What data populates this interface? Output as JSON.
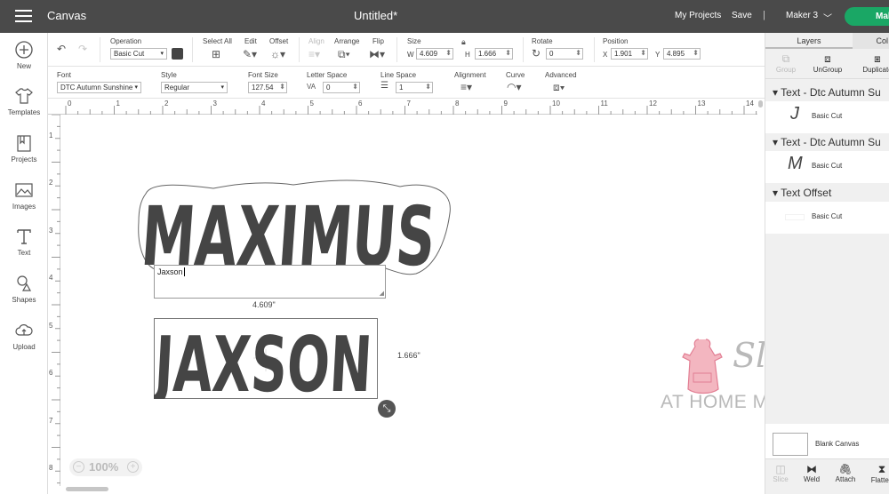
{
  "topbar": {
    "app_title": "Canvas",
    "doc_title": "Untitled*",
    "my_projects": "My Projects",
    "save": "Save",
    "separator": "|",
    "machine": "Maker 3",
    "make": "Make"
  },
  "sidebar": {
    "items": [
      {
        "label": "New",
        "icon": "plus-circle-icon"
      },
      {
        "label": "Templates",
        "icon": "tshirt-icon"
      },
      {
        "label": "Projects",
        "icon": "projects-icon"
      },
      {
        "label": "Images",
        "icon": "image-icon"
      },
      {
        "label": "Text",
        "icon": "text-icon"
      },
      {
        "label": "Shapes",
        "icon": "shapes-icon"
      },
      {
        "label": "Upload",
        "icon": "upload-cloud-icon"
      }
    ]
  },
  "toolbar1": {
    "operation_label": "Operation",
    "operation_value": "Basic Cut",
    "select_all": "Select All",
    "edit": "Edit",
    "offset": "Offset",
    "align": "Align",
    "arrange": "Arrange",
    "flip": "Flip",
    "size": "Size",
    "w_label": "W",
    "w_value": "4.609",
    "h_label": "H",
    "h_value": "1.666",
    "rotate": "Rotate",
    "rotate_value": "0",
    "position": "Position",
    "x_label": "X",
    "x_value": "1.901",
    "y_label": "Y",
    "y_value": "4.895"
  },
  "toolbar2": {
    "font_label": "Font",
    "font_value": "DTC Autumn Sunshine",
    "style_label": "Style",
    "style_value": "Regular",
    "font_size_label": "Font Size",
    "font_size_value": "127.54",
    "letter_space_label": "Letter Space",
    "letter_space_value": "0",
    "line_space_label": "Line Space",
    "line_space_value": "1",
    "alignment_label": "Alignment",
    "curve_label": "Curve",
    "advanced_label": "Advanced"
  },
  "ruler": {
    "h": [
      "0",
      "1",
      "2",
      "3",
      "4",
      "5",
      "6",
      "7",
      "8",
      "9",
      "10",
      "11",
      "12",
      "13",
      "14"
    ],
    "v": [
      "1",
      "2",
      "3",
      "4",
      "5",
      "6",
      "7",
      "8"
    ]
  },
  "canvas": {
    "word1": "MAXIMUS",
    "word2": "JAXSON",
    "textbox_value": "Jaxson",
    "width_dim": "4.609\"",
    "height_dim": "1.666\"",
    "zoom": "100%"
  },
  "watermark": {
    "script": "Slay",
    "sub": "AT HOME MOTHER"
  },
  "right_panel": {
    "tabs": [
      "Layers",
      "Col"
    ],
    "actions_top": [
      "Group",
      "UnGroup",
      "Duplicate"
    ],
    "layers": [
      {
        "title": "Text - Dtc Autumn Su",
        "item": "Basic Cut",
        "glyph": "J"
      },
      {
        "title": "Text - Dtc Autumn Su",
        "item": "Basic Cut",
        "glyph": "M"
      },
      {
        "title": "Text Offset",
        "item": "Basic Cut",
        "glyph": ""
      }
    ],
    "blank_canvas": "Blank Canvas",
    "actions_bottom": [
      "Slice",
      "Weld",
      "Attach",
      "Flatten"
    ]
  },
  "colors": {
    "topbar": "#4a4a4a",
    "make_button": "#1aa765",
    "text_fill": "#454545",
    "watermark_pink": "#e89aa8"
  }
}
